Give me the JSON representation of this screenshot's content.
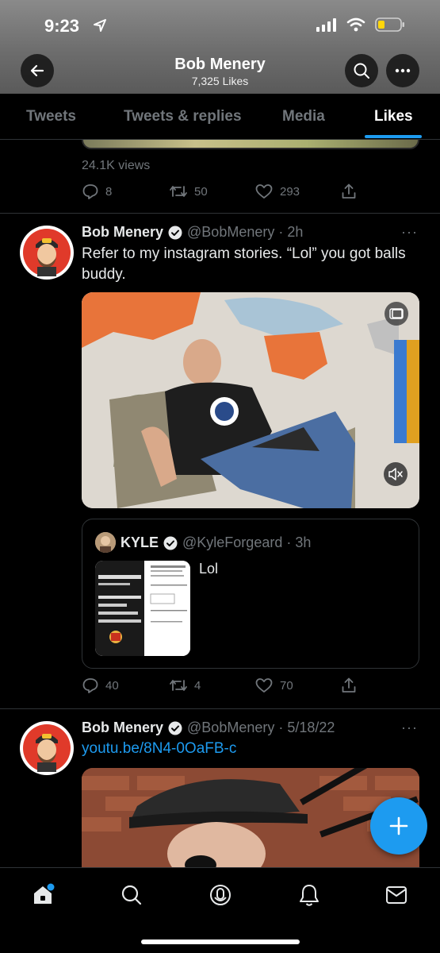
{
  "status_bar": {
    "time": "9:23"
  },
  "header": {
    "title": "Bob Menery",
    "subtitle": "7,325 Likes"
  },
  "tabs": [
    {
      "label": "Tweets"
    },
    {
      "label": "Tweets & replies"
    },
    {
      "label": "Media"
    },
    {
      "label": "Likes",
      "active": true
    }
  ],
  "prev_tweet": {
    "views": "24.1K views",
    "replies": "8",
    "retweets": "50",
    "likes": "293"
  },
  "tweet1": {
    "name": "Bob Menery",
    "handle": "@BobMenery · 2h",
    "text": "Refer to my instagram stories. “Lol” you got balls buddy.",
    "media_icons": [
      "captions-icon",
      "mute-icon"
    ],
    "quote": {
      "name": "KYLE",
      "handle": "@KyleForgeard · 3h",
      "text": "Lol"
    },
    "replies": "40",
    "retweets": "4",
    "likes": "70"
  },
  "tweet2": {
    "name": "Bob Menery",
    "handle": "@BobMenery · 5/18/22",
    "link": "youtu.be/8N4-0OaFB-c"
  },
  "colors": {
    "accent": "#1d9bf0",
    "verified": "#e7e9ea",
    "muted": "#71767b"
  },
  "bottom_nav": [
    "home-icon",
    "search-icon",
    "spaces-icon",
    "notifications-icon",
    "messages-icon"
  ]
}
